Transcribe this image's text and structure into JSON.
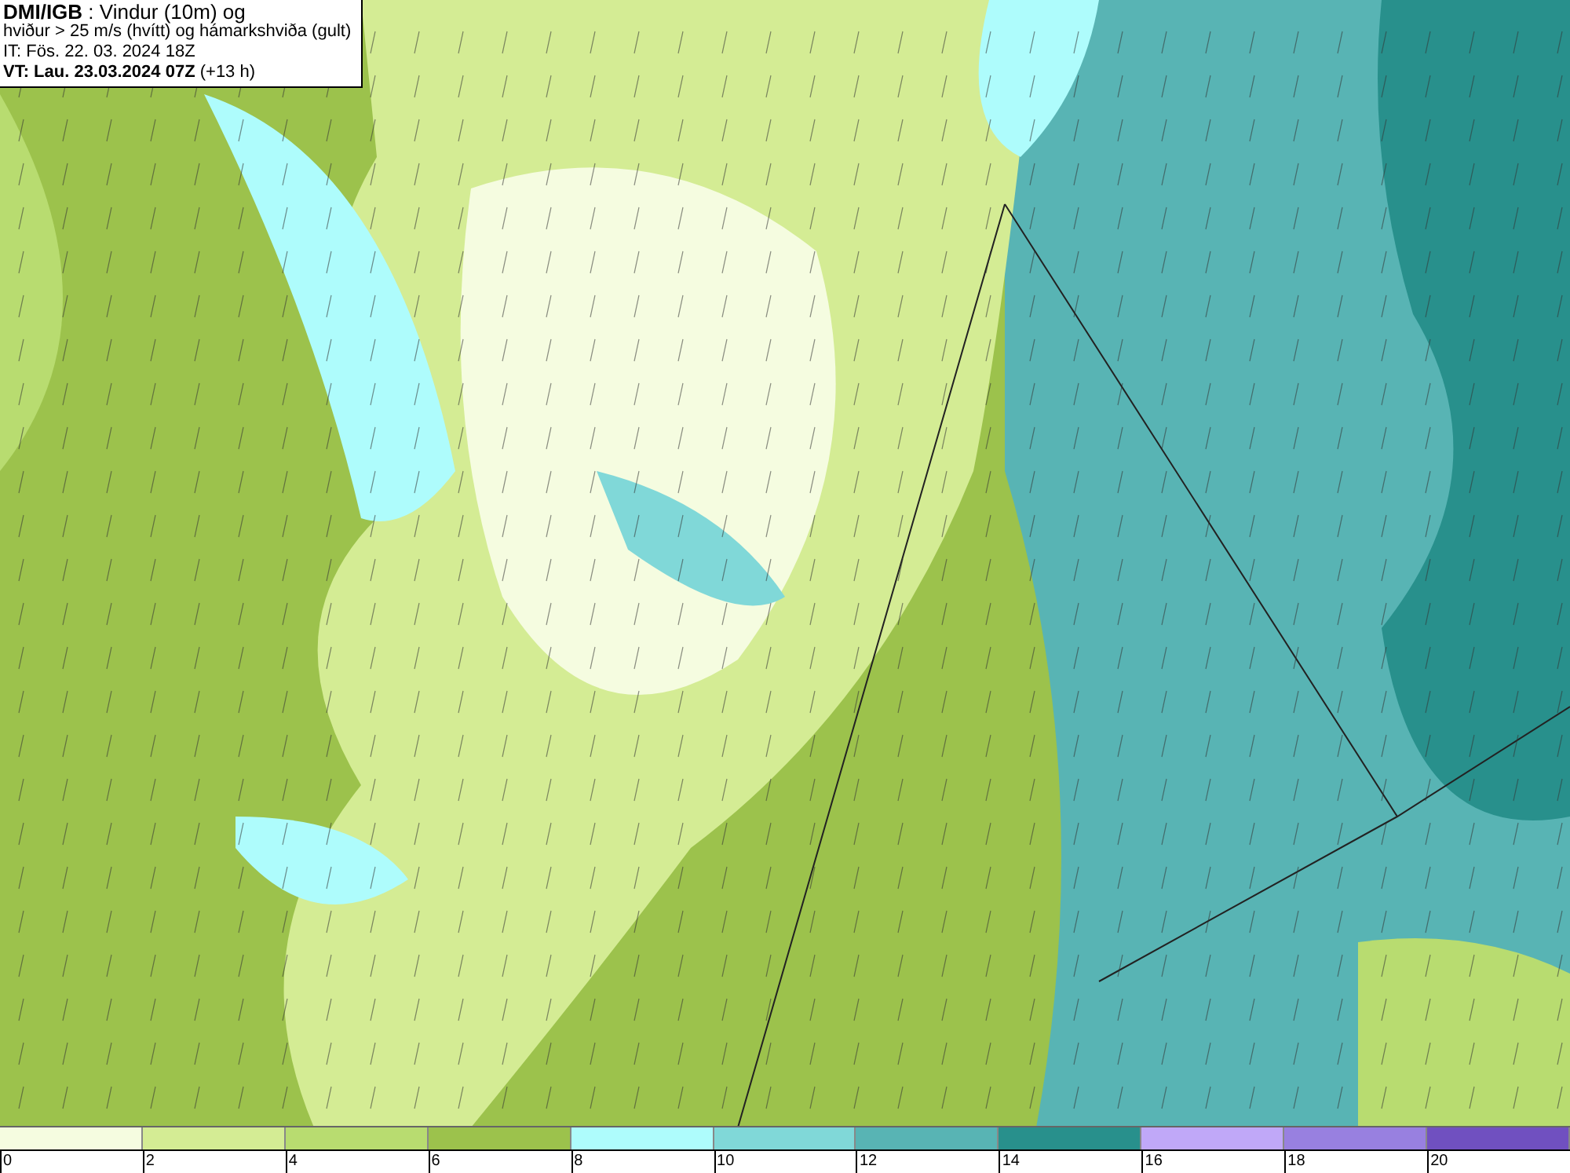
{
  "header": {
    "lines": [
      "**DMI/IGB** : Vindur (10m) og",
      "hviður > 25 m/s (hvítt) og hámarkshviða (gult)",
      "IT: Fös. 22. 03. 2024 18Z",
      "**VT: Lau. 23.03.2024 07Z** (+13 h)"
    ]
  },
  "legend": {
    "segments": [
      {
        "color": "#f5fce0",
        "label": "0"
      },
      {
        "color": "#d4ec94",
        "label": "2"
      },
      {
        "color": "#b8dc70",
        "label": "4"
      },
      {
        "color": "#9cc24c",
        "label": "6"
      },
      {
        "color": "#aefcfc",
        "label": "8"
      },
      {
        "color": "#80d8d8",
        "label": "10"
      },
      {
        "color": "#58b4b4",
        "label": "12"
      },
      {
        "color": "#28908c",
        "label": "14"
      },
      {
        "color": "#c0a8f8",
        "label": "16"
      },
      {
        "color": "#9880e0",
        "label": "18"
      },
      {
        "color": "#7050c0",
        "label": "20"
      }
    ]
  }
}
